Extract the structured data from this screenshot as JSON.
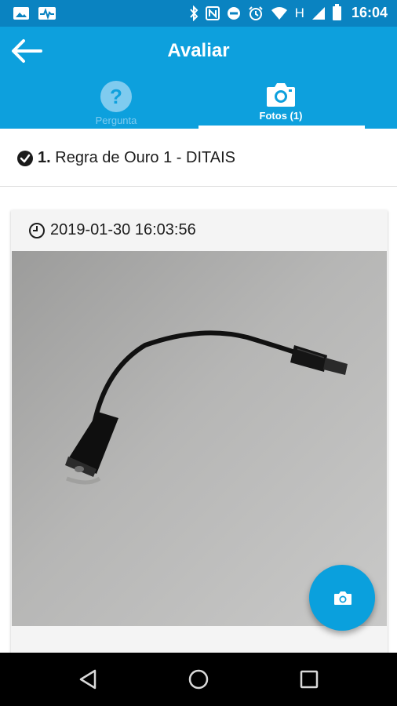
{
  "statusbar": {
    "time": "16:04",
    "network_letter": "H",
    "icons": [
      "image-notification-icon",
      "pulse-notification-icon",
      "bluetooth-icon",
      "nfc-icon",
      "do-not-disturb-icon",
      "alarm-icon",
      "wifi-icon",
      "signal-icon",
      "battery-icon"
    ]
  },
  "appbar": {
    "title": "Avaliar",
    "back_icon": "arrow-left-icon",
    "tabs": [
      {
        "label": "Pergunta",
        "icon": "question-circle-icon",
        "active": false
      },
      {
        "label": "Fotos (1)",
        "icon": "camera-icon",
        "active": true
      }
    ],
    "colors": {
      "statusbar": "#0a83c1",
      "appbar": "#0da0dd",
      "inactive_tab": "#7fcbef"
    }
  },
  "question": {
    "icon": "check-circle-icon",
    "number": "1.",
    "text": "Regra de Ouro 1 - DITAIS"
  },
  "photo_card": {
    "clock_icon": "clock-icon",
    "timestamp": "2019-01-30 16:03:56",
    "photo_subject": "black audio adapter cable on grey surface"
  },
  "fab": {
    "icon": "camera-icon",
    "color": "#0aa0dd"
  },
  "navbar": {
    "buttons": [
      "back-triangle-icon",
      "home-circle-icon",
      "recents-square-icon"
    ]
  }
}
